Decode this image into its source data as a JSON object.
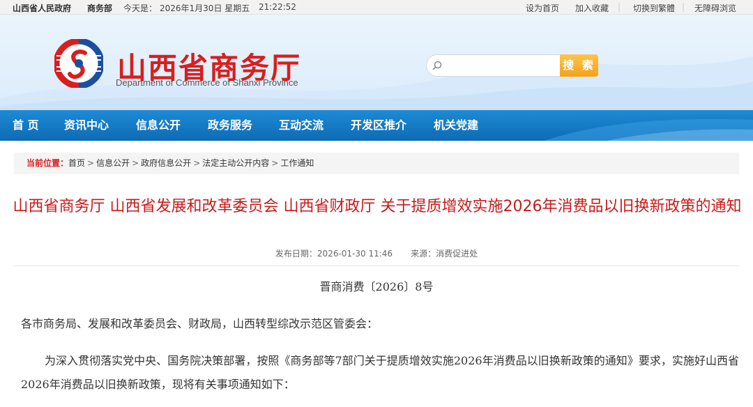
{
  "topbar": {
    "link_gov": "山西省人民政府",
    "link_mofcom": "商务部",
    "today_label": "今天是：",
    "date": "2026年1月30日 星期五",
    "time": "21:22:52",
    "set_home": "设为首页",
    "add_fav": "加入收藏",
    "switch_trad": "切换到繁體",
    "accessible": "无障碍浏览"
  },
  "header": {
    "title": "山西省商务厅",
    "subtitle": "Department of Commerce of Shanxi Province",
    "search_placeholder": "",
    "search_button": "搜 索",
    "brand_color": "#d81e1e"
  },
  "nav": {
    "items": [
      {
        "label": "首  页"
      },
      {
        "label": "资讯中心"
      },
      {
        "label": "信息公开"
      },
      {
        "label": "政务服务"
      },
      {
        "label": "互动交流"
      },
      {
        "label": "开发区推介"
      },
      {
        "label": "机关党建"
      }
    ],
    "color": "#1379c5"
  },
  "breadcrumb": {
    "label": "当前位置：",
    "items": [
      "首页",
      "信息公开",
      "政府信息公开",
      "法定主动公开内容",
      "工作通知"
    ],
    "separator": ">"
  },
  "article": {
    "title": "山西省商务厅 山西省发展和改革委员会 山西省财政厅 关于提质增效实施2026年消费品以旧换新政策的通知",
    "publish_label": "发布日期：",
    "publish_date": "2026-01-30 11:46",
    "source_label": "来源：",
    "source": "消费促进处",
    "doc_no": "晋商消费〔2026〕8号",
    "para1": "各市商务局、发展和改革委员会、财政局，山西转型综改示范区管委会：",
    "para2": "为深入贯彻落实党中央、国务院决策部署，按照《商务部等7部门关于提质增效实施2026年消费品以旧换新政策的通知》要求，实施好山西省2026年消费品以旧换新政策，现将有关事项通知如下："
  }
}
